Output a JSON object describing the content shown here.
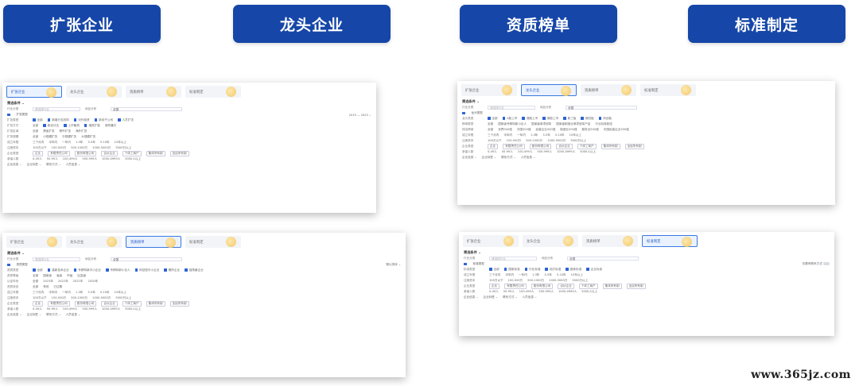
{
  "headers": [
    "扩张企业",
    "龙头企业",
    "资质榜单",
    "标准制定"
  ],
  "tabs": [
    "扩张企业",
    "龙头企业",
    "资质榜单",
    "标准制定"
  ],
  "filter_title": "筛选条件 ⌄",
  "common": {
    "industry_label": "行业分类",
    "industry_placeholder": "请选择行业",
    "region_label": "地区分布",
    "region_value": "全国",
    "est_label": "成立年限",
    "est_values": [
      "三个月内",
      "半年内",
      "一年内",
      "1-3年",
      "3-5年",
      "5-10年",
      "10年以上"
    ],
    "capital_label": "注册资本",
    "capital_values": [
      "100万以下",
      "100-500万",
      "500-1000万",
      "1000-5000万",
      "5000万以上"
    ],
    "type_label": "企业类型",
    "type_values": [
      "企业",
      "有限责任公司",
      "股份有限公司",
      "合伙企业",
      "个体工商户",
      "集体所有制",
      "全民所有制"
    ],
    "scale_label": "参保人数",
    "scale_values": [
      "0-49人",
      "50-99人",
      "100-499人",
      "500-999人",
      "1000-4999人",
      "5000人以上"
    ],
    "bottom": [
      "企业信息 ⌄",
      "企业标签 ⌄",
      "联系方式 ⌄",
      "人员信息 ⌄"
    ]
  },
  "p1": {
    "sub": "扩张类型",
    "year_range": "2019 — 2023 ⌄",
    "types": [
      "全部",
      "新增分支机构",
      "对外投资",
      "新设子公司",
      "人员扩张"
    ],
    "row2_label": "扩张方式",
    "row2": [
      "全部",
      "新设分支",
      "上市融资",
      "增资扩股",
      "收购兼并"
    ],
    "row3_label": "扩张区域",
    "row3": [
      "全部",
      "跨省扩张",
      "跨市扩张",
      "海外扩张"
    ],
    "row4_label": "扩张规模",
    "row4": [
      "全部",
      "小规模扩张",
      "中规模扩张",
      "大规模扩张"
    ]
  },
  "p2": {
    "sub": "龙头类型",
    "types": [
      "全部",
      "A股上市",
      "港股上市",
      "美股上市",
      "新三板",
      "新四板",
      "科创板"
    ],
    "row2_label": "榜单类型",
    "row2": [
      "全部",
      "国家级专精特新小巨人",
      "国家级单项冠军",
      "国家级制造业单项冠军产品",
      "行业标准制定"
    ],
    "row3_label": "排名榜单",
    "row3": [
      "全部",
      "世界500强",
      "中国500强",
      "民营企业500强",
      "制造业500强",
      "服务业500强",
      "中国民营企业500强"
    ]
  },
  "p3": {
    "sub": "资质类型",
    "sort_label": "默认排序 ⌄",
    "types": [
      "全部",
      "高新技术企业",
      "专精特新中小企业",
      "专精特新小巨人",
      "科技型中小企业",
      "瞪羚企业",
      "独角兽企业"
    ],
    "row2_label": "资质等级",
    "row2": [
      "全部",
      "国家级",
      "省级",
      "市级",
      "区县级"
    ],
    "row3_label": "认定年份",
    "row3": [
      "全部",
      "2023年",
      "2022年",
      "2021年",
      "2020年"
    ],
    "row4_label": "资质状态",
    "row4": [
      "全部",
      "有效",
      "已过期"
    ]
  },
  "p4": {
    "sub": "标准类型",
    "switch_label": "仅看有联系方式",
    "types": [
      "全部",
      "国家标准",
      "行业标准",
      "地方标准",
      "团体标准",
      "企业标准"
    ]
  },
  "watermark": "www.365jz.com"
}
